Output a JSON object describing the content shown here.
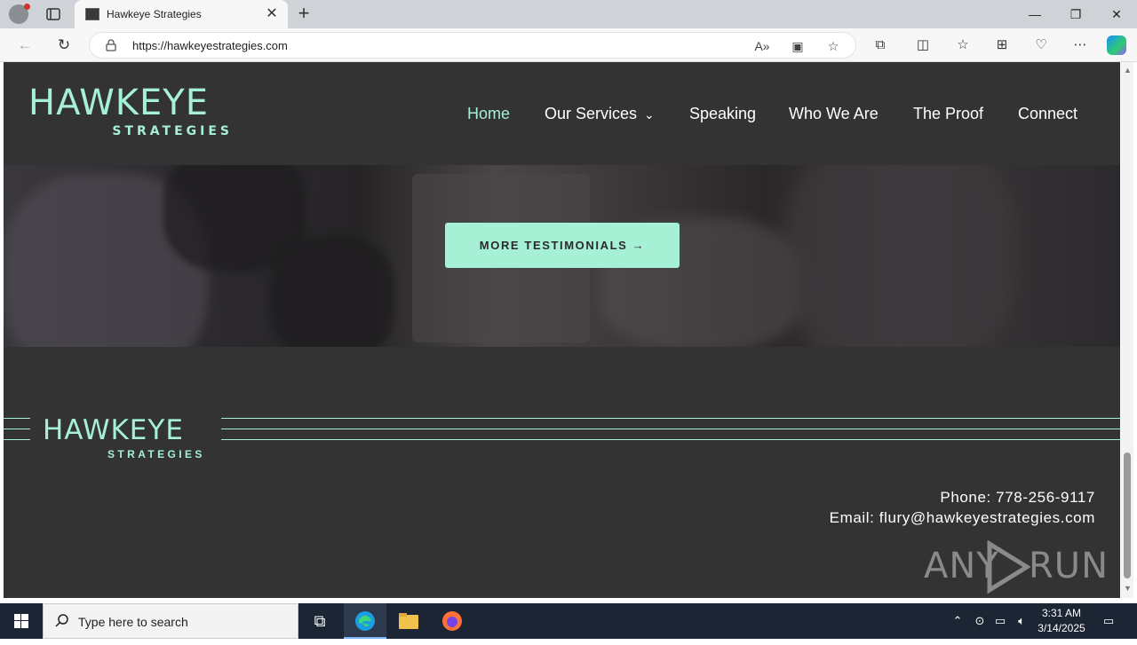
{
  "browser": {
    "tab_title": "Hawkeye Strategies",
    "tab_close": "✕",
    "new_tab": "+",
    "url": "https://hawkeyestrategies.com",
    "window_controls": {
      "minimize": "—",
      "restore": "❐",
      "close": "✕"
    }
  },
  "site": {
    "logo": {
      "main": "HAWKEYE",
      "sub": "STRATEGIES"
    },
    "nav": [
      {
        "label": "Home",
        "active": true
      },
      {
        "label": "Our Services",
        "has_dropdown": true
      },
      {
        "label": "Speaking"
      },
      {
        "label": "Who We Are"
      },
      {
        "label": "The Proof"
      },
      {
        "label": "Connect"
      }
    ],
    "cta_label": "MORE TESTIMONIALS →",
    "footer": {
      "logo": {
        "main": "HAWKEYE",
        "sub": "STRATEGIES"
      },
      "phone": "Phone: 778-256-9117",
      "email": "Email: flury@hawkeyestrategies.com"
    },
    "watermark": {
      "left": "ANY",
      "right": "RUN"
    },
    "accent_color": "#a6f0d6",
    "background_color": "#333333"
  },
  "taskbar": {
    "search_placeholder": "Type here to search",
    "time": "3:31 AM",
    "date": "3/14/2025"
  }
}
